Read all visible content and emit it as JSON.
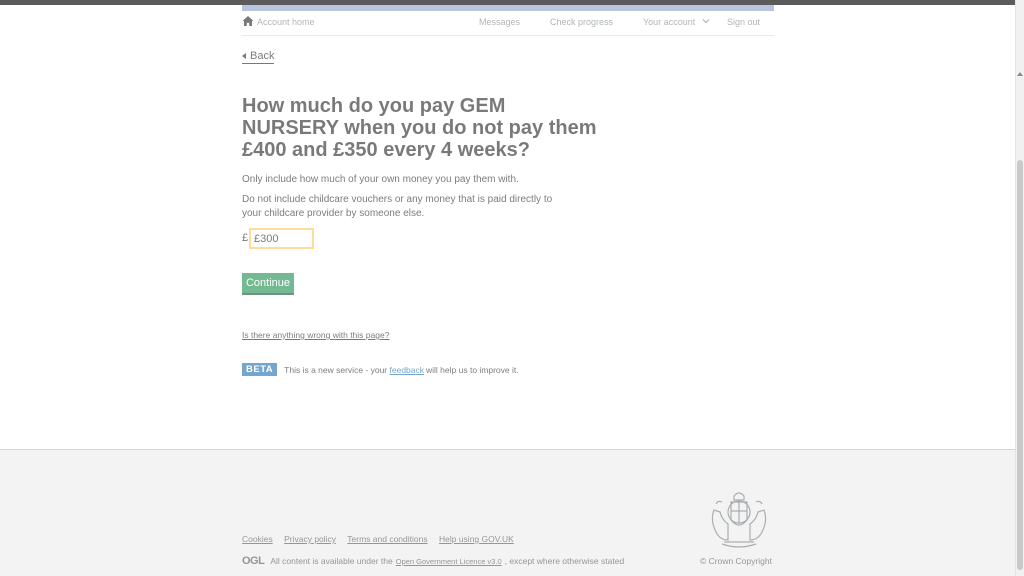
{
  "nav": {
    "home_label": "Account home",
    "messages": "Messages",
    "check_progress": "Check progress",
    "your_account": "Your account",
    "sign_out": "Sign out"
  },
  "back_label": "Back",
  "question": {
    "heading": "How much do you pay GEM NURSERY when you do not pay them £400 and £350 every 4 weeks?",
    "hint_1": "Only include how much of your own money you pay them with.",
    "hint_2": "Do not include childcare vouchers or any money that is paid directly to your childcare provider by someone else.",
    "currency_symbol": "£",
    "amount_value": "£300"
  },
  "continue_label": "Continue",
  "report_link": "Is there anything wrong with this page?",
  "beta": {
    "tag": "BETA",
    "text_before": "This is a new service  - your",
    "feedback_link": "feedback",
    "text_after": "will help us to improve it."
  },
  "footer": {
    "links": [
      "Cookies",
      "Privacy policy",
      "Terms and conditions",
      "Help using GOV.UK"
    ],
    "ogl_logo": "OGL",
    "licence_before": "All content is available under the",
    "licence_link": "Open Government Licence v3.0",
    "licence_after": ", except where otherwise stated",
    "copyright": "© Crown Copyright"
  },
  "colors": {
    "brand_blue": "#005ea5",
    "button_green": "#00823b",
    "focus_yellow": "#ffbf47",
    "footer_bg": "#f3f3f3"
  },
  "icons": {
    "home": "home-icon",
    "account_dropdown": "chevron-down-icon",
    "back": "caret-left-icon",
    "crest": "royal-coat-of-arms-icon"
  }
}
